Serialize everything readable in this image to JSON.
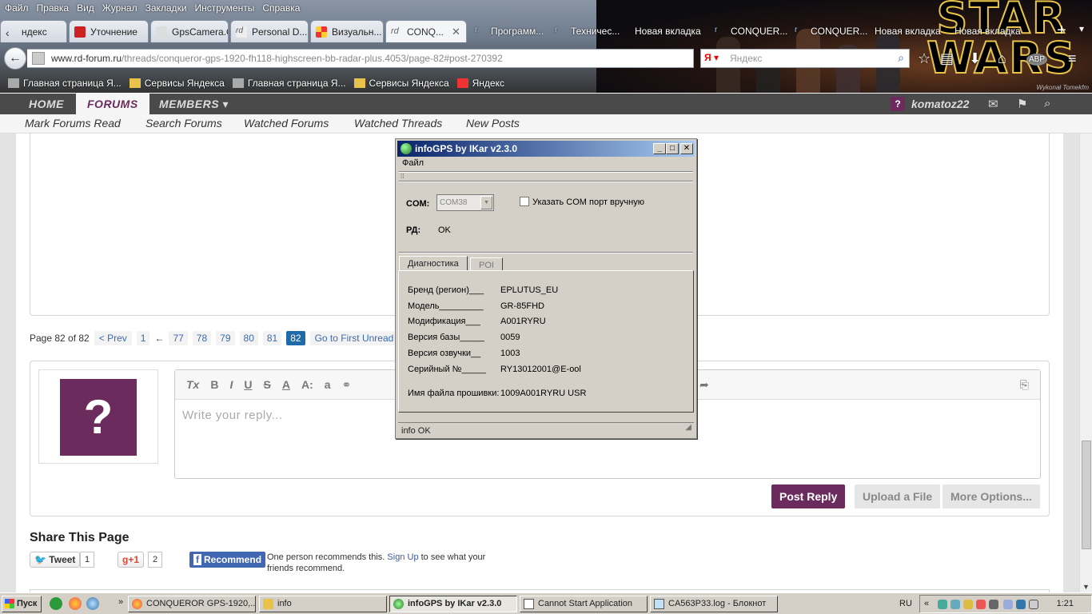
{
  "browser": {
    "menu": [
      "Файл",
      "Правка",
      "Вид",
      "Журнал",
      "Закладки",
      "Инструменты",
      "Справка"
    ],
    "tabs": [
      {
        "label": "ндекс",
        "color": "#e33"
      },
      {
        "label": "Уточнение",
        "color": "#c22"
      },
      {
        "label": "GpsCamera.Org",
        "color": "#eee"
      },
      {
        "label": "Personal D...",
        "color": "#666"
      },
      {
        "label": "Визуальн...",
        "color": "#d33"
      },
      {
        "label": "CONQ...",
        "color": "#666"
      },
      {
        "label": "Программ...",
        "color": "#333"
      },
      {
        "label": "Техничес...",
        "color": "#333"
      },
      {
        "label": "Новая вкладка",
        "color": ""
      },
      {
        "label": "CONQUER...",
        "color": "#333"
      },
      {
        "label": "CONQUER...",
        "color": "#333"
      },
      {
        "label": "Новая вкладка",
        "color": ""
      },
      {
        "label": "Новая вкладка",
        "color": ""
      }
    ],
    "url_host": "www.rd-forum.ru",
    "url_path": "/threads/conqueror-gps-1920-fh118-highscreen-bb-radar-plus.4053/page-82#post-270392",
    "search_engine": "Я",
    "search_placeholder": "Яндекс",
    "bookmarks": [
      "Главная страница Я...",
      "Сервисы Яндекса",
      "Главная страница Я...",
      "Сервисы Яндекса",
      "Яндекс"
    ],
    "banner": {
      "logo_line1": "STAR",
      "logo_line2": "WARS",
      "credit": "Wykonał Tomekfm"
    },
    "abp_label": "ABP"
  },
  "forum": {
    "nav": {
      "home": "HOME",
      "forums": "FORUMS",
      "members": "MEMBERS",
      "username": "komatoz22"
    },
    "subnav": [
      "Mark Forums Read",
      "Search Forums",
      "Watched Forums",
      "Watched Threads",
      "New Posts"
    ],
    "pagination": {
      "label": "Page 82 of 82",
      "prev": "< Prev",
      "first": "1",
      "ellipsis": "←",
      "pages": [
        "77",
        "78",
        "79",
        "80",
        "81"
      ],
      "current": "82",
      "first_unread": "Go to First Unread"
    },
    "reply": {
      "avatar_char": "?",
      "toolbar": [
        "Tx",
        "B",
        "I",
        "U",
        "S",
        "A",
        "A:",
        "a"
      ],
      "placeholder": "Write your reply...",
      "post_button": "Post Reply",
      "upload_button": "Upload a File",
      "more_button": "More Options..."
    },
    "share": {
      "heading": "Share This Page",
      "tweet": "Tweet",
      "tweet_count": "1",
      "gplus": "+1",
      "gplus_count": "2",
      "fb_button": "Recommend",
      "fb_text": "One person recommends this.",
      "fb_link": "Sign Up",
      "fb_text2": "to see what your friends recommend."
    }
  },
  "infogps": {
    "title": "infoGPS  by IKar v2.3.0",
    "menu_file": "Файл",
    "com_label": "COM:",
    "com_value": "COM38",
    "manual_checkbox": "Указать COM  порт вручную",
    "rd_label": "РД:",
    "rd_value": "OK",
    "tabs": [
      "Диагностика",
      "POI"
    ],
    "rows": [
      {
        "label": "Бренд (регион)___",
        "value": "EPLUTUS_EU"
      },
      {
        "label": "Модель_________",
        "value": "GR-85FHD"
      },
      {
        "label": "Модификация___",
        "value": "A001RYRU"
      },
      {
        "label": "Версия базы_____",
        "value": "0059"
      },
      {
        "label": "Версия озвучки__",
        "value": "1003"
      },
      {
        "label": "Серийный №_____",
        "value": "RY13012001@E-ool"
      },
      {
        "label": "Имя файла прошивки:",
        "value": "1009A001RYRU USR"
      }
    ],
    "status": "info OK"
  },
  "taskbar": {
    "start": "Пуск",
    "tasks": [
      "CONQUEROR GPS-1920,...",
      "info",
      "infoGPS  by IKar v2.3.0",
      "Cannot Start Application",
      "CA563P33.log - Блокнот"
    ],
    "lang": "RU",
    "clock": "1:21"
  }
}
